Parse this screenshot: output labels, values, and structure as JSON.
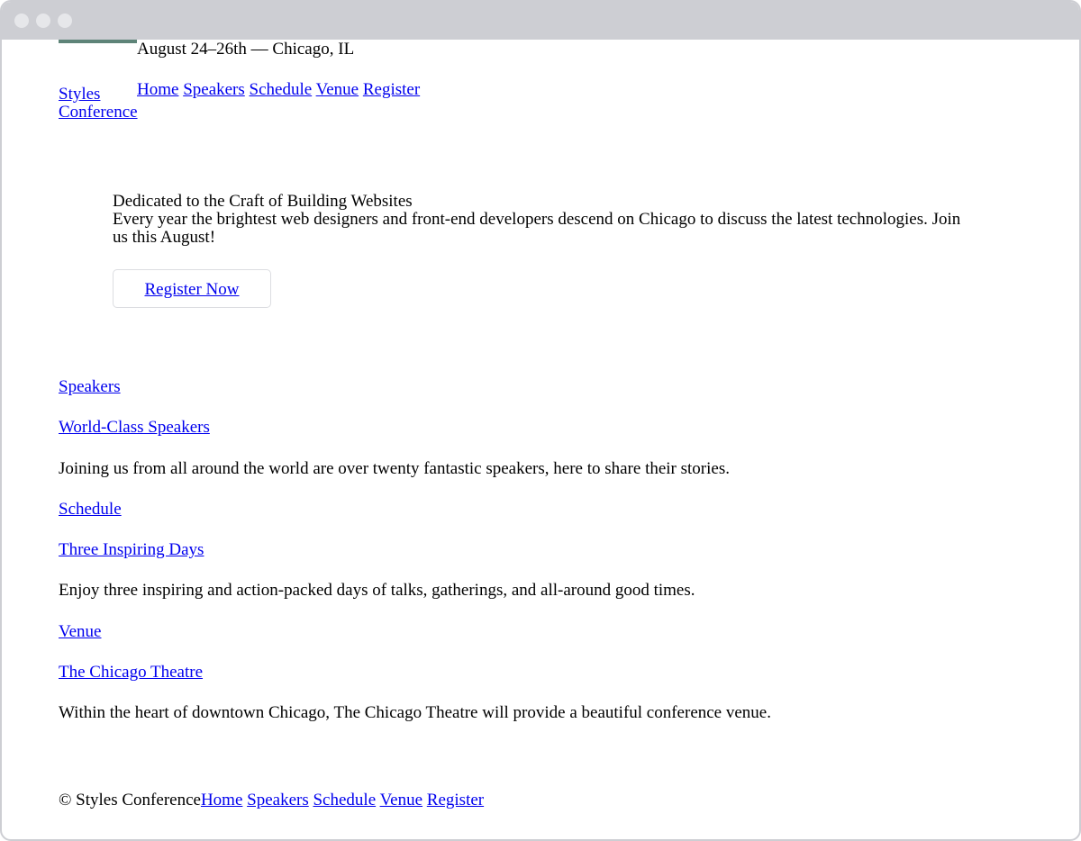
{
  "window": {
    "controls": [
      "close",
      "minimize",
      "maximize"
    ]
  },
  "header": {
    "logo_line1": "Styles",
    "logo_line2": "Conference",
    "tagline": "August 24–26th — Chicago, IL",
    "nav": [
      "Home",
      "Speakers",
      "Schedule",
      "Venue",
      "Register"
    ]
  },
  "hero": {
    "title": "Dedicated to the Craft of Building Websites",
    "text": "Every year the brightest web designers and front-end developers descend on Chicago to discuss the latest technologies. Join us this August!",
    "button_label": "Register Now"
  },
  "sections": [
    {
      "label": "Speakers",
      "heading": "World-Class Speakers",
      "text": "Joining us from all around the world are over twenty fantastic speakers, here to share their stories."
    },
    {
      "label": "Schedule",
      "heading": "Three Inspiring Days",
      "text": "Enjoy three inspiring and action-packed days of talks, gatherings, and all-around good times."
    },
    {
      "label": "Venue",
      "heading": "The Chicago Theatre",
      "text": "Within the heart of downtown Chicago, The Chicago Theatre will provide a beautiful conference venue."
    }
  ],
  "footer": {
    "copyright": "© Styles Conference",
    "nav": [
      "Home",
      "Speakers",
      "Schedule",
      "Venue",
      "Register"
    ]
  },
  "colors": {
    "link": "#0000ee",
    "logo_accent": "#5e8478",
    "chrome": "#cdced3"
  }
}
